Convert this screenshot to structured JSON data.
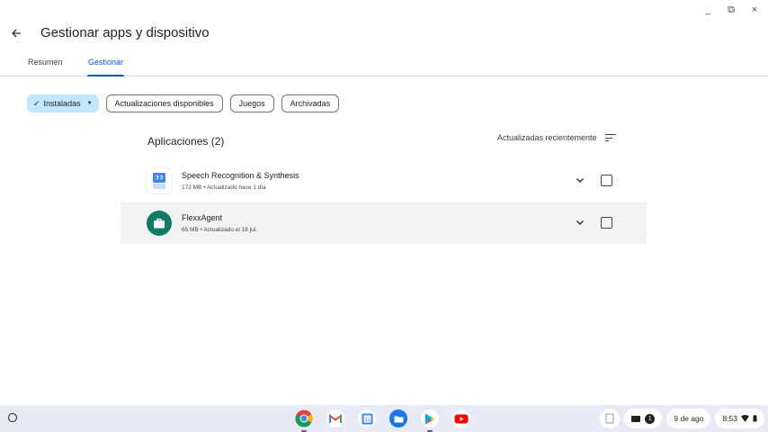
{
  "window": {
    "minimize": "_",
    "maximize": "⧉",
    "close": "×"
  },
  "header": {
    "back_icon": "arrow-back-icon",
    "title": "Gestionar apps y dispositivo"
  },
  "tabs": [
    {
      "label": "Resumen",
      "selected": false
    },
    {
      "label": "Gestionar",
      "selected": true
    }
  ],
  "chips": [
    {
      "label": "Instaladas",
      "selected": true
    },
    {
      "label": "Actualizaciones disponibles",
      "selected": false
    },
    {
      "label": "Juegos",
      "selected": false
    },
    {
      "label": "Archivadas",
      "selected": false
    }
  ],
  "list": {
    "title": "Aplicaciones (2)",
    "sort_label": "Actualizadas recientemente",
    "apps": [
      {
        "name": "Speech Recognition & Synthesis",
        "size": "172 MB",
        "updated": "Actualizado hace 1 día",
        "icon": "speech-services-icon"
      },
      {
        "name": "FlexxAgent",
        "size": "65 MB",
        "updated": "Actualizado el 18 jul.",
        "icon": "briefcase-icon"
      }
    ]
  },
  "shelf": {
    "apps": [
      "chrome-icon",
      "gmail-icon",
      "calendar-icon",
      "files-icon",
      "play-store-icon",
      "youtube-icon"
    ],
    "notification_count": "1",
    "date": "9 de ago",
    "time": "8:53"
  },
  "colors": {
    "accent": "#0b57d0",
    "chip_selected": "#c2e7ff",
    "row_highlight": "#f1f3f4",
    "flexx_green": "#117a65",
    "shelf": "#e8ebf5"
  }
}
